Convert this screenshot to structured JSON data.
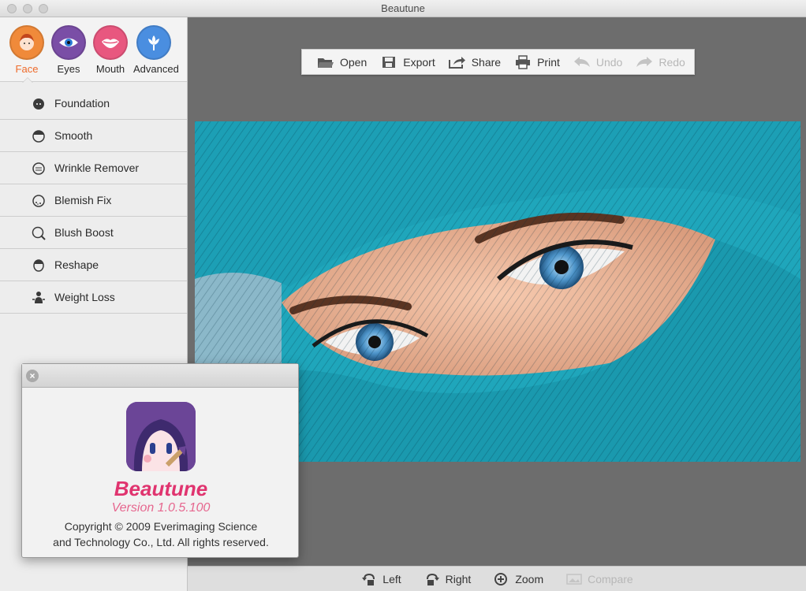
{
  "window": {
    "title": "Beautune"
  },
  "categories": [
    {
      "label": "Face",
      "icon": "face-icon",
      "color": "#f08a3a",
      "active": true
    },
    {
      "label": "Eyes",
      "icon": "eye-icon",
      "color": "#7a4ea6",
      "active": false
    },
    {
      "label": "Mouth",
      "icon": "mouth-icon",
      "color": "#e8577f",
      "active": false
    },
    {
      "label": "Advanced",
      "icon": "flower-icon",
      "color": "#4a8ee0",
      "active": false
    }
  ],
  "tools": [
    {
      "label": "Foundation",
      "icon": "foundation-face-icon"
    },
    {
      "label": "Smooth",
      "icon": "smooth-face-icon"
    },
    {
      "label": "Wrinkle Remover",
      "icon": "wrinkle-face-icon"
    },
    {
      "label": "Blemish Fix",
      "icon": "blemish-face-icon"
    },
    {
      "label": "Blush Boost",
      "icon": "blush-face-icon"
    },
    {
      "label": "Reshape",
      "icon": "reshape-face-icon"
    },
    {
      "label": "Weight Loss",
      "icon": "weight-loss-icon"
    }
  ],
  "toolbar": {
    "open": "Open",
    "export": "Export",
    "share": "Share",
    "print": "Print",
    "undo": "Undo",
    "redo": "Redo"
  },
  "bottombar": {
    "left": "Left",
    "right": "Right",
    "zoom": "Zoom",
    "compare": "Compare"
  },
  "about": {
    "app_name": "Beautune",
    "version": "Version 1.0.5.100",
    "copyright_line1": "Copyright © 2009 Everimaging Science",
    "copyright_line2": "and Technology Co., Ltd. All rights reserved."
  },
  "colors": {
    "accent_orange": "#ee6b2b",
    "brand_pink": "#e0346f",
    "workspace_bg": "#6d6d6d"
  }
}
